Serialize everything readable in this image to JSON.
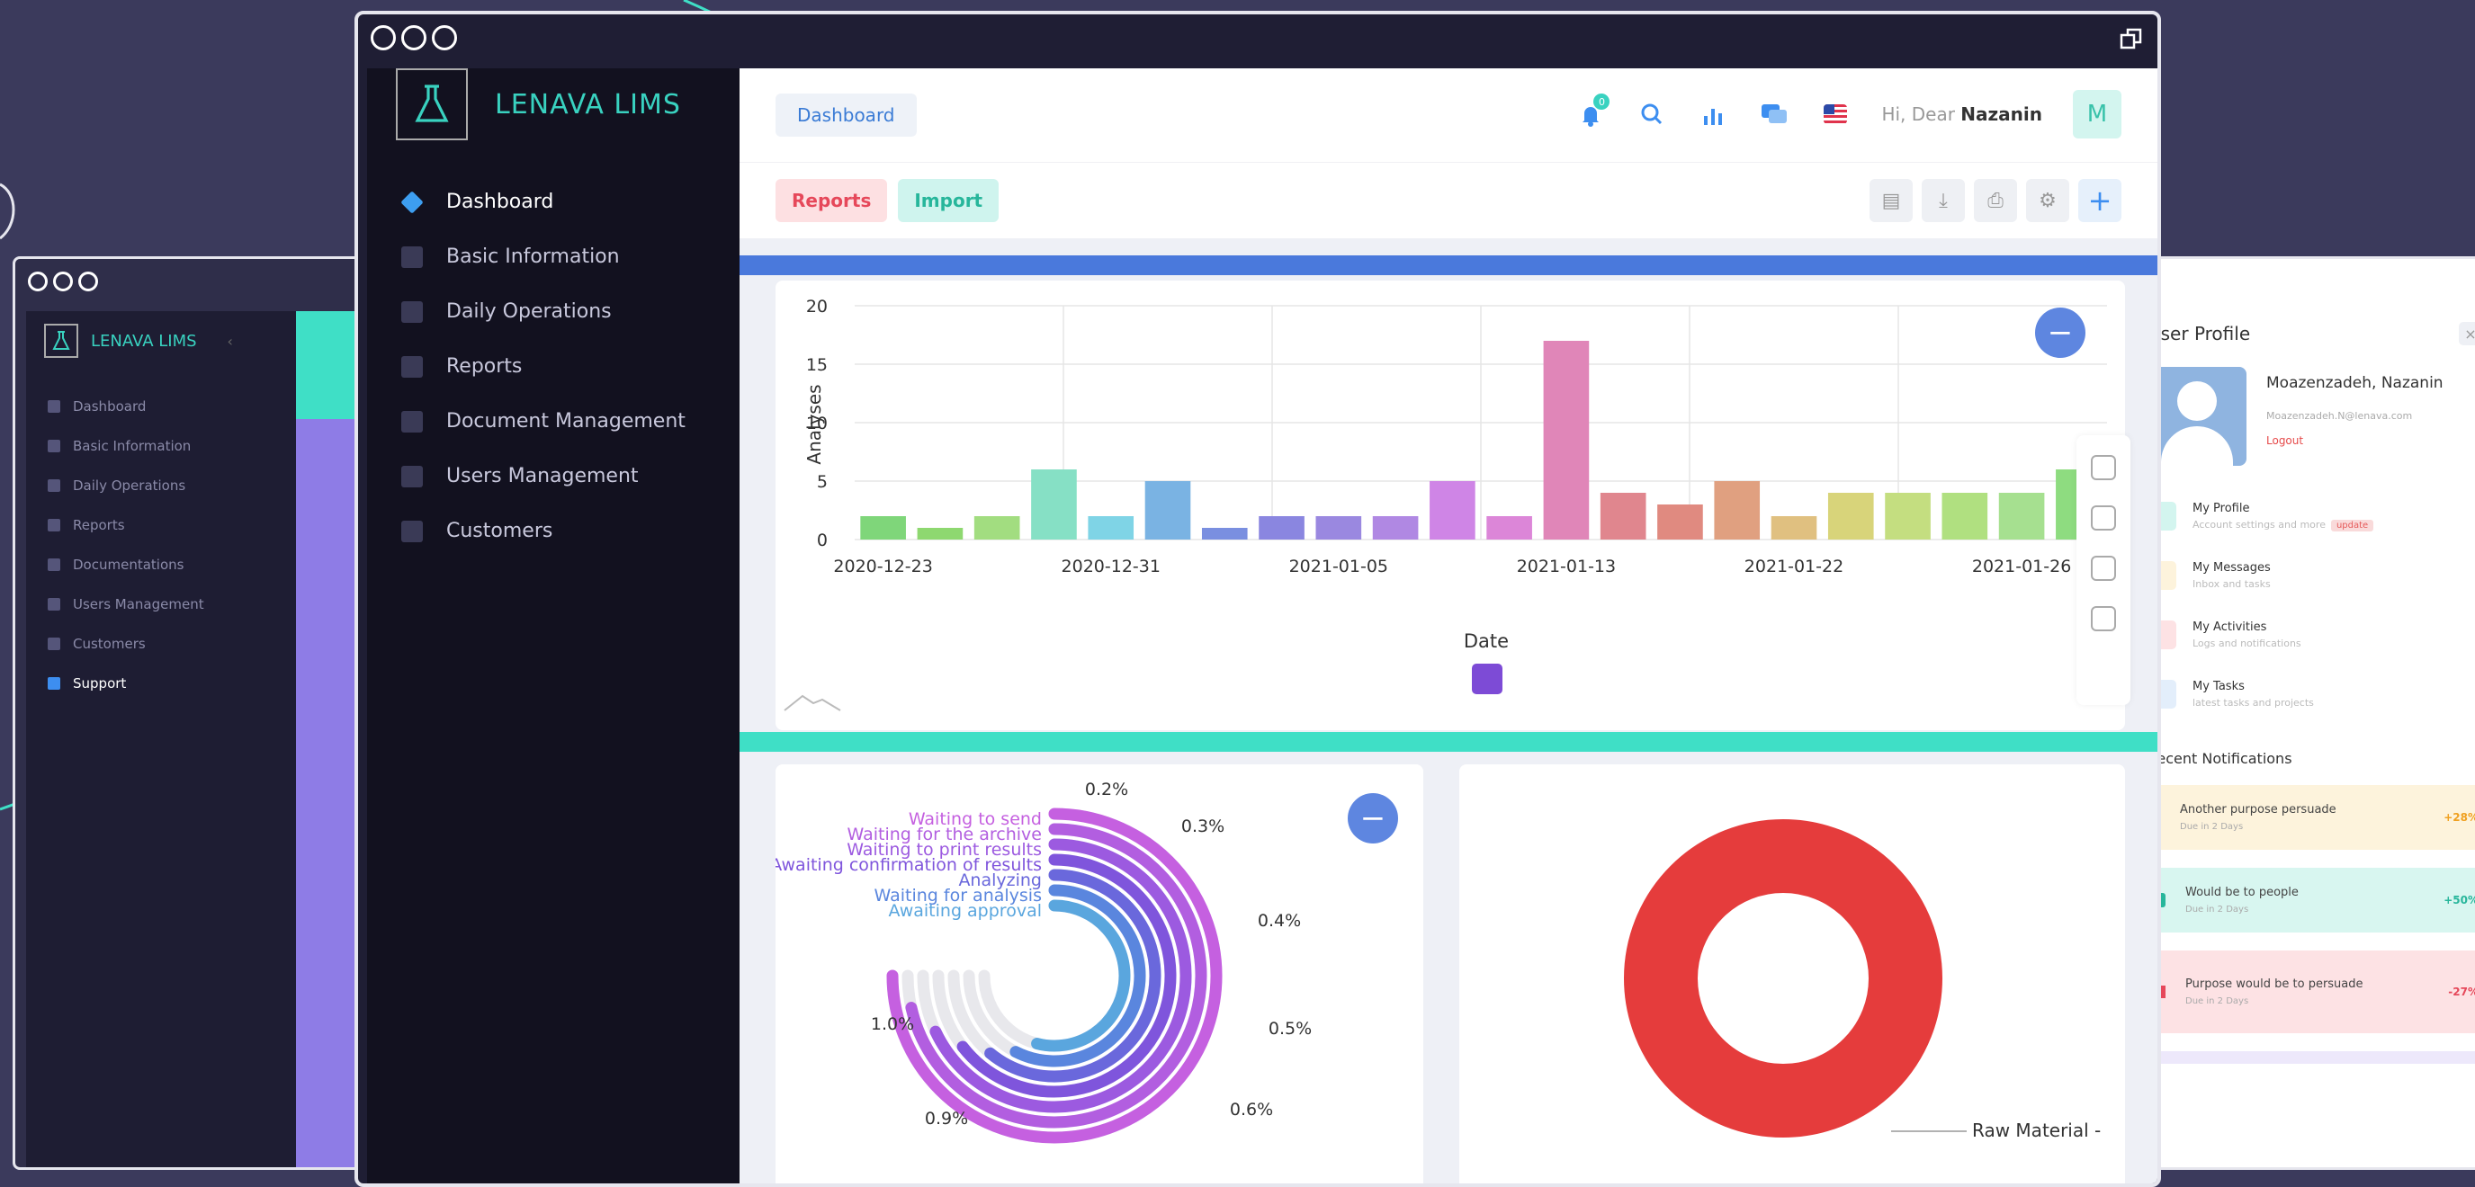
{
  "app": {
    "brand": "LENAVA LIMS"
  },
  "sidebar": {
    "items": [
      {
        "label": "Dashboard",
        "icon": "diamond-icon"
      },
      {
        "label": "Basic Information",
        "icon": "grid-icon"
      },
      {
        "label": "Daily Operations",
        "icon": "list-icon"
      },
      {
        "label": "Reports",
        "icon": "clipboard-icon"
      },
      {
        "label": "Document Management",
        "icon": "books-icon"
      },
      {
        "label": "Users Management",
        "icon": "user-icon"
      },
      {
        "label": "Customers",
        "icon": "users-icon"
      }
    ]
  },
  "sidebar_small": {
    "items": [
      {
        "label": "Dashboard"
      },
      {
        "label": "Basic Information"
      },
      {
        "label": "Daily Operations"
      },
      {
        "label": "Reports"
      },
      {
        "label": "Documentations"
      },
      {
        "label": "Users Management"
      },
      {
        "label": "Customers"
      },
      {
        "label": "Support"
      }
    ]
  },
  "header": {
    "breadcrumb": "Dashboard",
    "greeting_prefix": "Hi, Dear",
    "user_name": "Nazanin",
    "avatar_letter": "M",
    "notification_count": "0"
  },
  "toolbar": {
    "reports_label": "Reports",
    "import_label": "Import"
  },
  "user_profile": {
    "title": "User Profile",
    "close": "×",
    "name": "Moazenzadeh, Nazanin",
    "email": "Moazenzadeh.N@lenava.com",
    "logout": "Logout",
    "menu": [
      {
        "title": "My Profile",
        "subtitle": "Account settings and more",
        "badge": "update",
        "color": "#39c2aa"
      },
      {
        "title": "My Messages",
        "subtitle": "Inbox and tasks",
        "badge": "",
        "color": "#f5c542"
      },
      {
        "title": "My Activities",
        "subtitle": "Logs and notifications",
        "badge": "",
        "color": "#e64a5a"
      },
      {
        "title": "My Tasks",
        "subtitle": "latest tasks and projects",
        "badge": "",
        "color": "#3d8ef0"
      }
    ],
    "notifications_title": "Recent Notifications",
    "notifications": [
      {
        "text": "Another purpose persuade",
        "due": "Due in 2 Days",
        "pct": "+28%",
        "bg": "#fdf3dc",
        "color": "#f0a020"
      },
      {
        "text": "Would be to people",
        "due": "Due in 2 Days",
        "pct": "+50%",
        "bg": "#d8f6f0",
        "color": "#27b69b"
      },
      {
        "text": "Purpose would be to persuade",
        "due": "Due in 2 Days",
        "pct": "-27%",
        "bg": "#fde2e4",
        "color": "#e6485a"
      }
    ]
  },
  "chart_data": [
    {
      "type": "bar",
      "xlabel": "Date",
      "ylabel": "Analyses",
      "ylim": [
        0,
        20
      ],
      "yticks": [
        0,
        5,
        10,
        15,
        20
      ],
      "xtick_labels": [
        "2020-12-23",
        "2020-12-31",
        "2021-01-05",
        "2021-01-13",
        "2021-01-22",
        "2021-01-26"
      ],
      "values": [
        2,
        1,
        2,
        6,
        2,
        5,
        1,
        2,
        2,
        2,
        5,
        2,
        17,
        4,
        3,
        5,
        2,
        4,
        4,
        4,
        4,
        6
      ],
      "colors": [
        "#7fd67a",
        "#8ed870",
        "#a2dd80",
        "#86e0c5",
        "#7fd4e6",
        "#7ab3e3",
        "#7a8fe0",
        "#8a86e0",
        "#9a88e0",
        "#b088e3",
        "#cf85e6",
        "#dc86d8",
        "#e086b8",
        "#e0868e",
        "#e08a80",
        "#e0a080",
        "#e0c080",
        "#d8d47a",
        "#c4de80",
        "#b0e080",
        "#a6e090",
        "#8edc80"
      ],
      "legend": [
        {
          "name": "",
          "color": "#7d4bd6"
        }
      ]
    },
    {
      "type": "radialBar",
      "labels": [
        "Waiting to send",
        "Waiting for the archive",
        "Waiting to print results",
        "Awaiting confirmation of results",
        "Analyzing",
        "Waiting for analysis",
        "Awaiting approval"
      ],
      "value_labels": [
        "0.2%",
        "0.3%",
        "0.4%",
        "0.5%",
        "0.6%",
        "0.9%",
        "1.0%"
      ],
      "colors": [
        "#c560e0",
        "#b25ee0",
        "#9c5ae0",
        "#7f55dc",
        "#6a68dc",
        "#5a86de",
        "#5aa6de"
      ]
    },
    {
      "type": "pie",
      "labels": [
        "Raw Material - "
      ],
      "values": [
        100
      ],
      "colors": [
        "#e53c3c"
      ]
    }
  ]
}
